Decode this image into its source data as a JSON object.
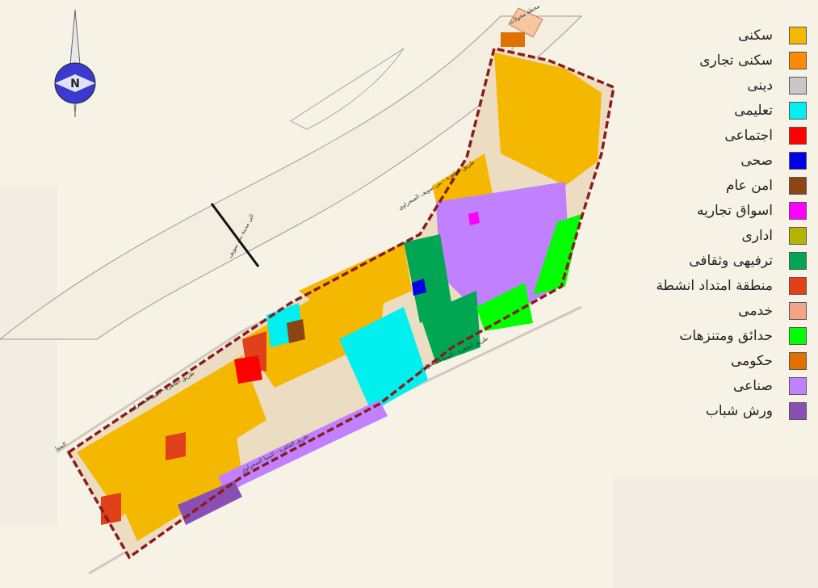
{
  "map": {
    "colors": {
      "background": "#f7f2e6",
      "river": "#f4efe2",
      "boundary": "#8a1c1c",
      "road": "#d9d4c8"
    },
    "road_labels": [
      "طريق القاهرة - بني سويف الصحراوي",
      "طريق القاهرة - المنيا الصحراوي",
      "طريق القاهرة - المنيا الصحراوي",
      "طريق القاهرة - المنيا الصحراوي",
      "المنيا",
      "الى مدينة بني سويف",
      "محطة محولات"
    ],
    "compass": {
      "letter": "N"
    }
  },
  "legend": {
    "items": [
      {
        "label": "سكنى",
        "color": "#f5b800"
      },
      {
        "label": "سكنى تجارى",
        "color": "#ff8a00"
      },
      {
        "label": "دينى",
        "color": "#c8c8c8"
      },
      {
        "label": "تعليمى",
        "color": "#00f0f0"
      },
      {
        "label": "اجتماعى",
        "color": "#ff0000"
      },
      {
        "label": "صحى",
        "color": "#0000e6"
      },
      {
        "label": "امن عام",
        "color": "#8b4513"
      },
      {
        "label": "اسواق تجاريه",
        "color": "#ff00ff"
      },
      {
        "label": "ادارى",
        "color": "#b5b500"
      },
      {
        "label": "ترفيهى وثقافى",
        "color": "#00a651"
      },
      {
        "label": "منطقة امتداد انشطة",
        "color": "#e0401a"
      },
      {
        "label": "خدمى",
        "color": "#f5a48a"
      },
      {
        "label": "حدائق ومتنزهات",
        "color": "#00ff00"
      },
      {
        "label": "حكومى",
        "color": "#e07000"
      },
      {
        "label": "صناعى",
        "color": "#c080ff"
      },
      {
        "label": "ورش شباب",
        "color": "#8a4fb5"
      }
    ]
  }
}
